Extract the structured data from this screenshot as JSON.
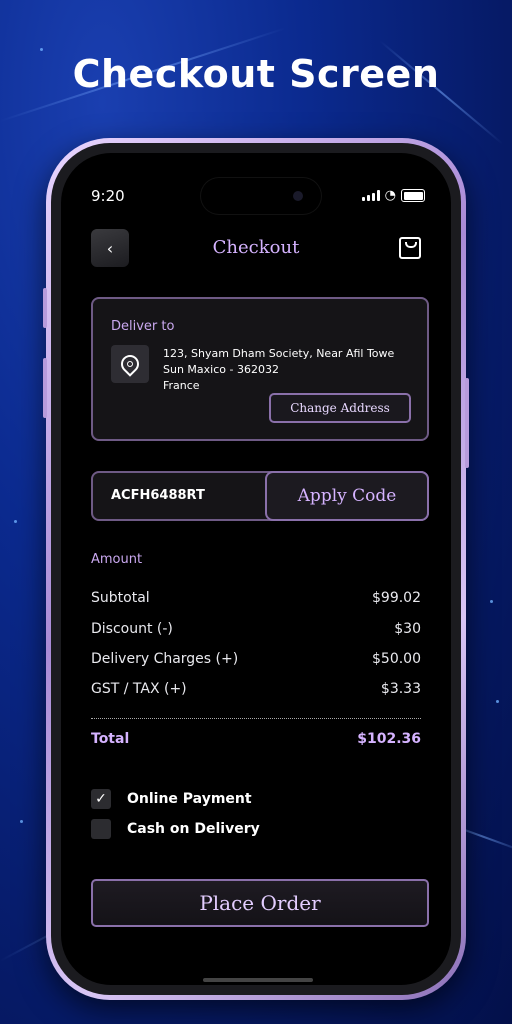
{
  "headline": "Checkout Screen",
  "status_bar": {
    "time": "9:20"
  },
  "header": {
    "title": "Checkout"
  },
  "deliver": {
    "label": "Deliver to",
    "address_lines": [
      "123, Shyam Dham Society, Near Afil Towe",
      "Sun Maxico - 362032",
      "France"
    ],
    "change_address": "Change Address"
  },
  "coupon": {
    "code": "ACFH6488RT",
    "apply_label": "Apply Code"
  },
  "amount": {
    "label": "Amount",
    "rows": [
      {
        "label": "Subtotal",
        "value": "$99.02"
      },
      {
        "label": "Discount (-)",
        "value": "$30"
      },
      {
        "label": "Delivery Charges (+)",
        "value": "$50.00"
      },
      {
        "label": "GST / TAX (+)",
        "value": "$3.33"
      }
    ],
    "total": {
      "label": "Total",
      "value": "$102.36"
    }
  },
  "payment": {
    "options": [
      {
        "label": "Online Payment",
        "checked": true
      },
      {
        "label": "Cash on Delivery",
        "checked": false
      }
    ]
  },
  "place_order": "Place Order",
  "colors": {
    "accent": "#d5b3ff",
    "border": "#8a70aa",
    "background": "#000000"
  }
}
